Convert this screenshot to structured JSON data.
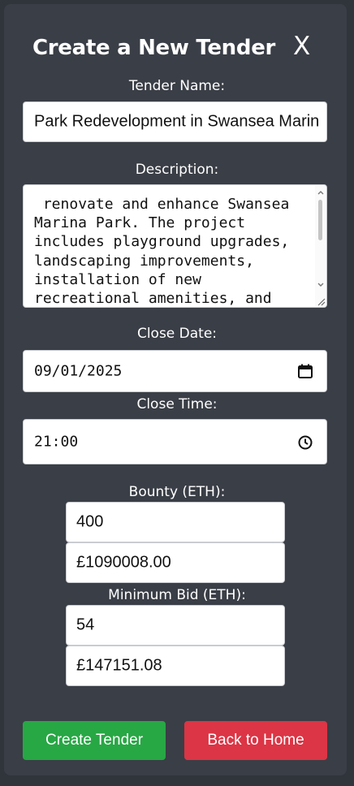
{
  "modal": {
    "title": "Create a New Tender",
    "close_label": "X"
  },
  "form": {
    "tender_name": {
      "label": "Tender Name:",
      "value": "Park Redevelopment in Swansea Marin"
    },
    "description": {
      "label": "Description:",
      "value": " renovate and enhance Swansea Marina Park. The project includes playground upgrades, landscaping improvements, installation of new recreational amenities, and"
    },
    "close_date": {
      "label": "Close Date:",
      "value": "09/01/2025",
      "icon": "calendar-icon"
    },
    "close_time": {
      "label": "Close Time:",
      "value": "21:00",
      "icon": "clock-icon"
    },
    "bounty": {
      "label": "Bounty (ETH):",
      "value": "400",
      "converted": "£1090008.00"
    },
    "minimum_bid": {
      "label": "Minimum Bid (ETH):",
      "value": "54",
      "converted": "£147151.08"
    }
  },
  "actions": {
    "create_label": "Create Tender",
    "back_label": "Back to Home"
  },
  "colors": {
    "background": "#30343b",
    "panel": "#3a3e46",
    "create_button": "#28a745",
    "back_button": "#dc3545"
  }
}
